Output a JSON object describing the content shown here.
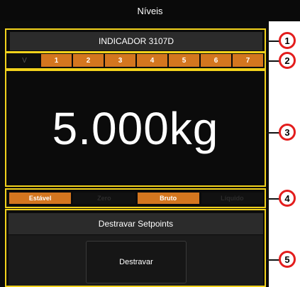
{
  "window": {
    "title": "Níveis"
  },
  "indicator": {
    "name": "INDICADOR 3107D"
  },
  "tabs": [
    {
      "label": "V",
      "active": false
    },
    {
      "label": "1",
      "active": true
    },
    {
      "label": "2",
      "active": true
    },
    {
      "label": "3",
      "active": true
    },
    {
      "label": "4",
      "active": true
    },
    {
      "label": "5",
      "active": true
    },
    {
      "label": "6",
      "active": true
    },
    {
      "label": "7",
      "active": true
    }
  ],
  "weight": {
    "value": "5.000kg"
  },
  "status": [
    {
      "label": "Estável",
      "active": true
    },
    {
      "label": "Zero",
      "active": false
    },
    {
      "label": "Bruto",
      "active": true
    },
    {
      "label": "Líquido",
      "active": false
    }
  ],
  "setpoints": {
    "header": "Destravar Setpoints",
    "button_label": "Destravar"
  },
  "callouts": [
    "1",
    "2",
    "3",
    "4",
    "5"
  ],
  "colors": {
    "accent": "#d4761f",
    "highlight_frame": "#f2d21c",
    "callout_ring": "#e31d1d"
  }
}
